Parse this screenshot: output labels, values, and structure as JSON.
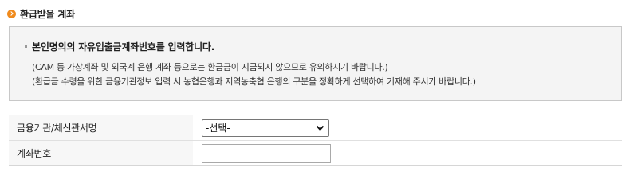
{
  "section": {
    "title": "환급받을 계좌",
    "icon": "orange-arrow-circle-icon",
    "accent_color": "#f08a1c"
  },
  "notice": {
    "heading": "본인명의의 자유입출금계좌번호를 입력합니다.",
    "lines": [
      "(CAM 등 가상계좌 및 외국계 은행 계좌 등으로는 환급금이 지급되지 않으므로 유의하시기 바랍니다.)",
      "(환급금 수령을 위한 금융기관정보 입력 시 농협은행과 지역농축협 은행의 구분을 정확하게 선택하여 기재해 주시기 바랍니다.)"
    ]
  },
  "form": {
    "bank_label": "금융기관/체신관서명",
    "bank_selected": "-선택-",
    "account_label": "계좌번호",
    "account_value": ""
  }
}
